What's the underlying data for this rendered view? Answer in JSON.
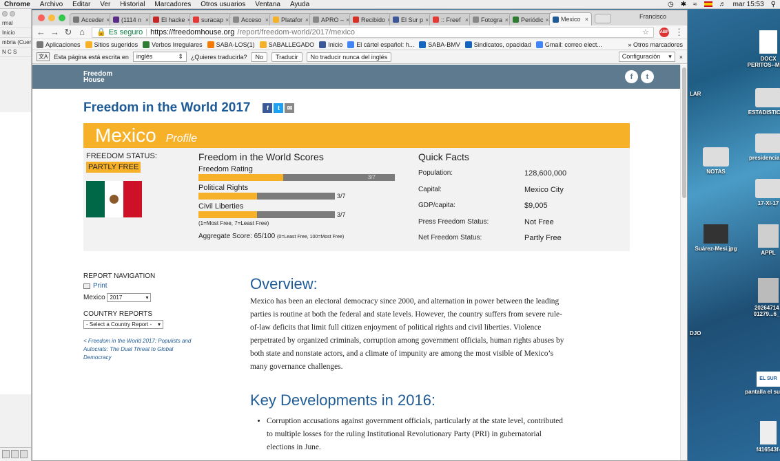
{
  "menubar": {
    "app": "Chrome",
    "items": [
      "Archivo",
      "Editar",
      "Ver",
      "Historial",
      "Marcadores",
      "Otros usuarios",
      "Ventana",
      "Ayuda"
    ],
    "clock": "mar 15:53"
  },
  "bg_app": {
    "rows": [
      "rmal",
      "Inicio",
      "mbria (Cuerp",
      "N  C  S"
    ]
  },
  "tabs": [
    {
      "label": "Acceder",
      "color": "#777"
    },
    {
      "label": "(1114 n",
      "color": "#5b2d86"
    },
    {
      "label": "El hacke",
      "color": "#c62828"
    },
    {
      "label": "suracap",
      "color": "#e53935"
    },
    {
      "label": "Acceso",
      "color": "#888"
    },
    {
      "label": "Platafor",
      "color": "#f6b128"
    },
    {
      "label": "APRO –",
      "color": "#888"
    },
    {
      "label": "Recibido",
      "color": "#d93025"
    },
    {
      "label": "El Sur p",
      "color": "#3b5998"
    },
    {
      "label": ":: Freef",
      "color": "#e53935"
    },
    {
      "label": "Fotogra",
      "color": "#888"
    },
    {
      "label": "Periódic",
      "color": "#2e7d32"
    },
    {
      "label": "Mexico",
      "color": "#1f5b96"
    }
  ],
  "user": "Francisco",
  "url": {
    "secure": "Es seguro",
    "domain": "https://freedomhouse.org",
    "path": "/report/freedom-world/2017/mexico"
  },
  "bookmarks": [
    {
      "label": "Aplicaciones",
      "color": "#777"
    },
    {
      "label": "Sitios sugeridos",
      "color": "#f6b128"
    },
    {
      "label": "Verbos Irregulares",
      "color": "#2e7d32"
    },
    {
      "label": "SABA-LOS(1)",
      "color": "#f57c00"
    },
    {
      "label": "SABALLEGADO",
      "color": "#f6b128"
    },
    {
      "label": "Inicio",
      "color": "#3b5998"
    },
    {
      "label": "El cártel español: h...",
      "color": "#4285f4"
    },
    {
      "label": "SABA-BMV",
      "color": "#1565c0"
    },
    {
      "label": "Sindicatos, opacidad",
      "color": "#1565c0"
    },
    {
      "label": "Gmail: correo elect...",
      "color": "#4285f4"
    }
  ],
  "bookmarks_more": "»  Otros marcadores",
  "translate": {
    "prompt": "Esta página está escrita en",
    "lang": "inglés",
    "ask": "¿Quieres traducirla?",
    "no": "No",
    "yes": "Traducir",
    "never": "No traducir nunca del inglés",
    "config": "Configuración"
  },
  "site": {
    "logo_line1": "Freedom",
    "logo_line2": "House"
  },
  "page_title": "Freedom in the World 2017",
  "banner": {
    "country": "Mexico",
    "profile": "Profile"
  },
  "status": {
    "label": "FREEDOM STATUS:",
    "value": "PARTLY FREE"
  },
  "scores": {
    "title": "Freedom in the World Scores",
    "rating": {
      "label": "Freedom Rating",
      "value": "3/7",
      "fraction": 0.43
    },
    "political": {
      "label": "Political Rights",
      "value": "3/7",
      "fraction": 0.43
    },
    "civil": {
      "label": "Civil Liberties",
      "value": "3/7",
      "fraction": 0.43
    },
    "note": "(1=Most Free, 7=Least Free)",
    "aggregate": "Aggregate Score: 65/100",
    "aggregate_note": "(0=Least Free, 100=Most Free)"
  },
  "quick_facts": {
    "title": "Quick Facts",
    "rows": [
      {
        "k": "Population:",
        "v": "128,600,000"
      },
      {
        "k": "Capital:",
        "v": "Mexico City"
      },
      {
        "k": "GDP/capita:",
        "v": "$9,005"
      },
      {
        "k": "Press Freedom Status:",
        "v": "Not Free"
      },
      {
        "k": "Net Freedom Status:",
        "v": "Partly Free"
      }
    ]
  },
  "nav": {
    "heading": "REPORT NAVIGATION",
    "print": "Print",
    "country_label": "Mexico",
    "year": "2017",
    "reports_heading": "COUNTRY REPORTS",
    "select_placeholder": "- Select a Country Report -",
    "link": "< Freedom in the World 2017: Populists and Autocrats: The Dual Threat to Global Democracy"
  },
  "overview": {
    "heading": "Overview:",
    "text": "Mexico has been an electoral democracy since 2000, and alternation in power between the leading parties is routine at both the federal and state levels. However, the country suffers from severe rule-of-law deficits that limit full citizen enjoyment of political rights and civil liberties. Violence perpetrated by organized criminals, corruption among government officials, human rights abuses by both state and nonstate actors, and a climate of impunity are among the most visible of Mexico’s many governance challenges."
  },
  "key_dev": {
    "heading": "Key Developments in 2016:",
    "items": [
      "Corruption accusations against government officials, particularly at the state level, contributed to multiple losses for the ruling Institutional Revolutionary Party (PRI) in gubernatorial elections in June."
    ]
  },
  "desktop": {
    "icons": [
      "DOCX",
      "PERITOS--MANI",
      "ESTADISTICOS",
      "presidenciable",
      "NOTAS",
      "17-XI-17",
      "Suárez-Mesi.jpg",
      "APPL",
      "20264714_",
      "01279...6_n",
      "EL SUR",
      "pantalla el sur.jpg",
      "f416543f-"
    ],
    "side": [
      "LAR",
      "DJO"
    ]
  }
}
